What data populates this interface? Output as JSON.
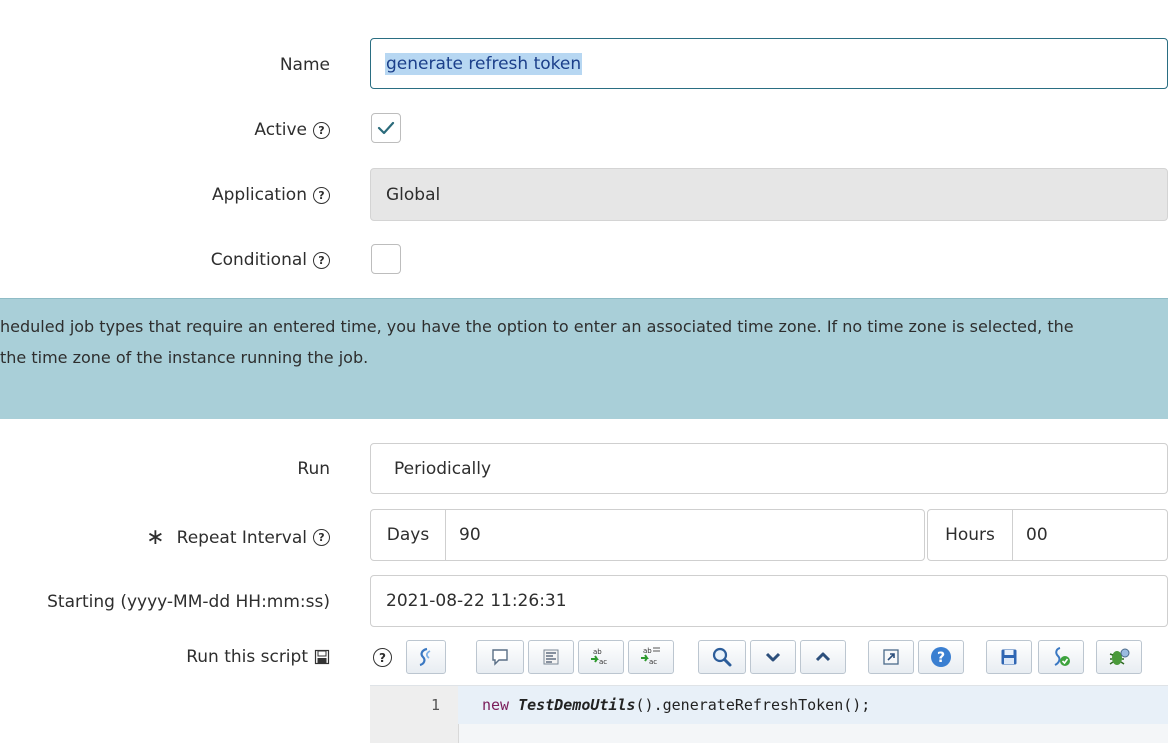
{
  "form": {
    "name": {
      "label": "Name",
      "value": "generate refresh token"
    },
    "active": {
      "label": "Active",
      "checked": true
    },
    "application": {
      "label": "Application",
      "value": "Global"
    },
    "conditional": {
      "label": "Conditional",
      "checked": false
    },
    "info_banner": {
      "line1": "heduled job types that require an entered time, you have the option to enter an associated time zone. If no time zone is selected, the",
      "line2": "the time zone of the instance running the job."
    },
    "run": {
      "label": "Run",
      "value": "Periodically"
    },
    "repeat_interval": {
      "required_marker": "∗",
      "label": "Repeat Interval",
      "days_label": "Days",
      "days_value": "90",
      "hours_label": "Hours",
      "hours_value": "00"
    },
    "starting": {
      "label": "Starting (yyyy-MM-dd HH:mm:ss)",
      "value": "2021-08-22 11:26:31"
    },
    "script": {
      "label": "Run this script",
      "line_number": "1",
      "code_keyword": "new",
      "code_class": "TestDemoUtils",
      "code_rest": "().generateRefreshToken();"
    }
  },
  "icons": {
    "help": "?",
    "toolbar": [
      "script-syntax-icon",
      "comment-icon",
      "format-code-icon",
      "replace-icon",
      "replace-all-icon",
      "search-icon",
      "find-next-icon",
      "find-previous-icon",
      "fullscreen-icon",
      "help-icon",
      "save-icon",
      "script-check-icon",
      "debug-icon"
    ]
  },
  "colors": {
    "banner": "#a9cfd8",
    "selection": "#b7d7f2",
    "focus_border": "#2a6e82"
  }
}
